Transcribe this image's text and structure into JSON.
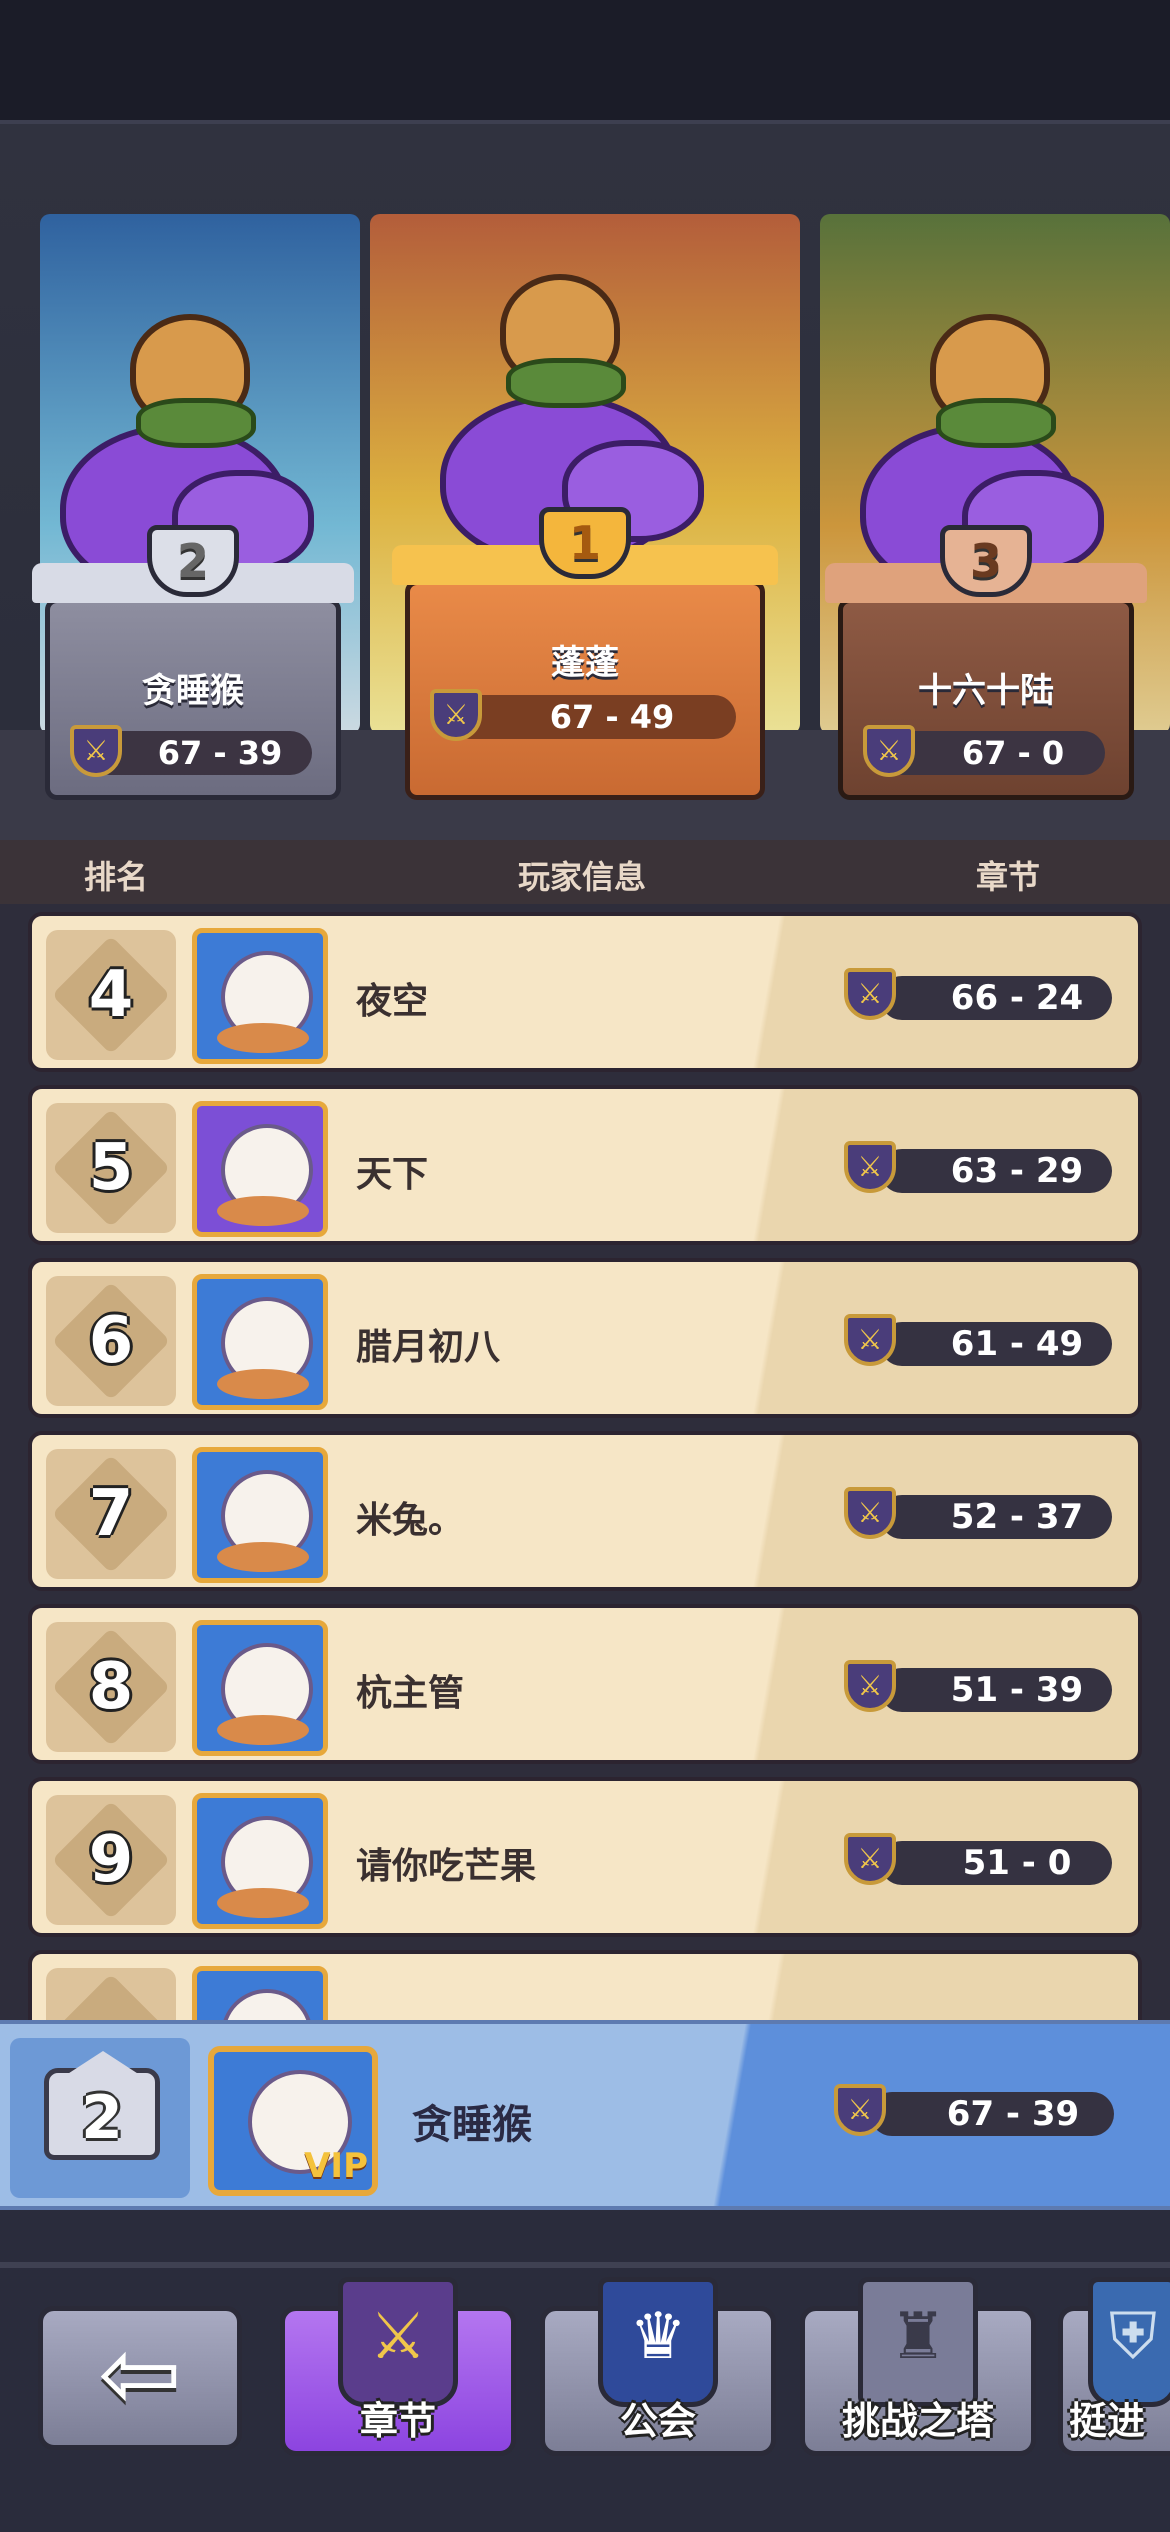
{
  "podium": [
    {
      "rank": "2",
      "name": "贪睡猴",
      "score": "67 - 39"
    },
    {
      "rank": "1",
      "name": "蓬蓬",
      "score": "67 - 49"
    },
    {
      "rank": "3",
      "name": "十六十陆",
      "score": "67 - 0"
    }
  ],
  "table_header": {
    "rank": "排名",
    "player": "玩家信息",
    "chapter": "章节"
  },
  "rows": [
    {
      "rank": "4",
      "name": "夜空",
      "score": "66 - 24"
    },
    {
      "rank": "5",
      "name": "天下",
      "score": "63 - 29"
    },
    {
      "rank": "6",
      "name": "腊月初八",
      "score": "61 - 49"
    },
    {
      "rank": "7",
      "name": "米兔。",
      "score": "52 - 37"
    },
    {
      "rank": "8",
      "name": "杭主管",
      "score": "51 - 39"
    },
    {
      "rank": "9",
      "name": "请你吃芒果",
      "score": "51 - 0"
    }
  ],
  "self": {
    "rank": "2",
    "name": "贪睡猴",
    "score": "67 - 39",
    "vip": "VIP"
  },
  "nav": {
    "back_icon": "arrow-left-icon",
    "tabs": [
      {
        "label": "章节",
        "icon": "chapter-banner-icon"
      },
      {
        "label": "公会",
        "icon": "guild-banner-icon"
      },
      {
        "label": "挑战之塔",
        "icon": "tower-icon"
      },
      {
        "label": "挺进",
        "icon": "advance-icon"
      }
    ]
  },
  "colors": {
    "accent_active_tab": "#8c44e0",
    "row_bg": "#f6e6c6",
    "self_bar": "#9dbde6"
  }
}
